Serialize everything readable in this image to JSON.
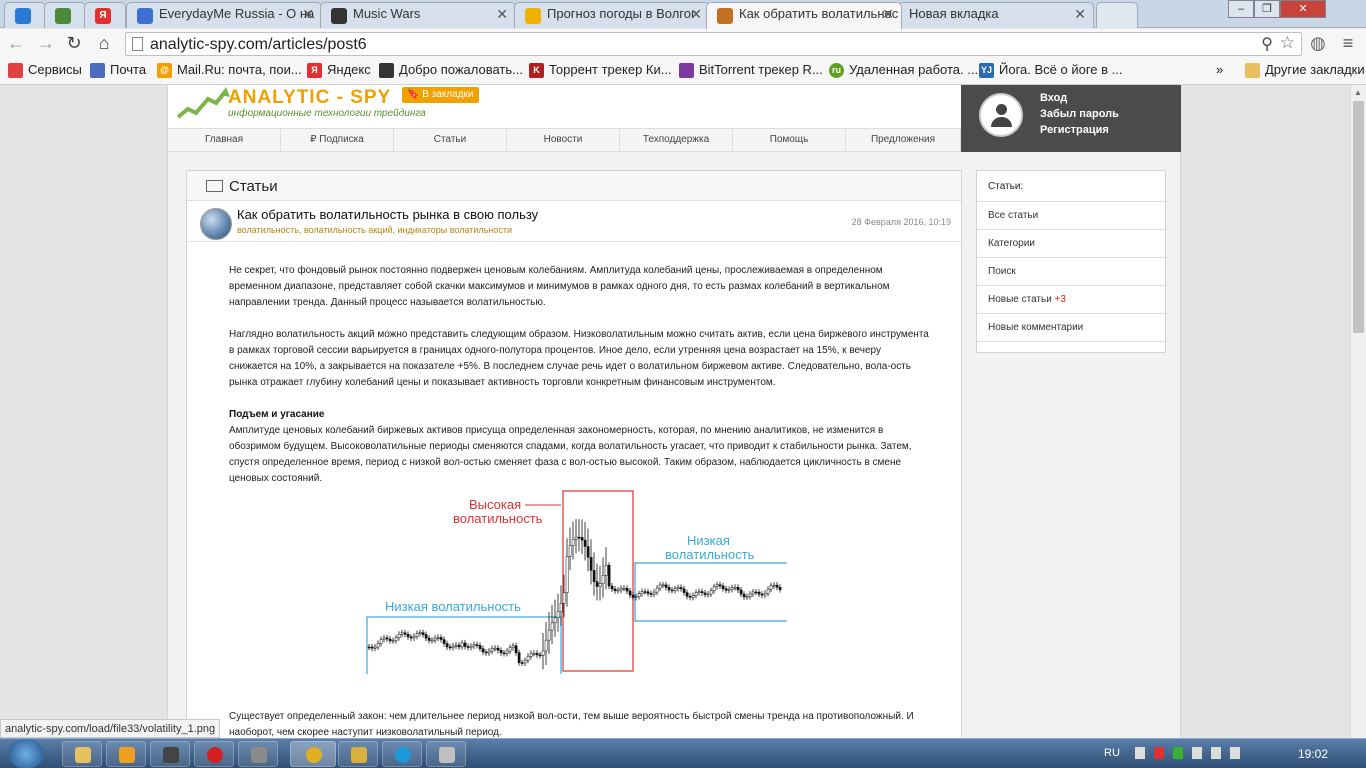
{
  "browser": {
    "tabs": [
      {
        "title": "",
        "icon": "generic-tab-icon",
        "color": "#2b7bd6"
      },
      {
        "title": "",
        "icon": "chart-tab-icon",
        "color": "#4a8a3a"
      },
      {
        "title": "",
        "icon": "yandex-tab-icon",
        "color": "#e03030"
      },
      {
        "title": "EverydayMe Russia - О на",
        "icon": "everydayme-icon",
        "color": "#3b6fd0"
      },
      {
        "title": "Music Wars",
        "icon": "musicwars-icon",
        "color": "#333"
      },
      {
        "title": "Прогноз погоды в Волгог",
        "icon": "weather-icon",
        "color": "#f0b000"
      },
      {
        "title": "Как обратить волатильнос",
        "icon": "article-icon",
        "color": "#c07020"
      },
      {
        "title": "Новая вкладка",
        "icon": "",
        "color": ""
      }
    ],
    "window_buttons": [
      "‒",
      "❐",
      "✕"
    ],
    "url": "analytic-spy.com/articles/post6",
    "bookmarks": [
      {
        "label": "Сервисы",
        "color": "#e04040"
      },
      {
        "label": "Почта",
        "color": "#4a6cc0"
      },
      {
        "label": "Mail.Ru: почта, пои...",
        "color": "#f0a000"
      },
      {
        "label": "Яндекс",
        "color": "#e03030"
      },
      {
        "label": "Добро пожаловать...",
        "color": "#333"
      },
      {
        "label": "Торрент трекер Ки...",
        "color": "#b02020"
      },
      {
        "label": "BitTorrent трекер R...",
        "color": "#7a3aa0"
      },
      {
        "label": "Удаленная работа. ...",
        "color": "#60a020"
      },
      {
        "label": "Йога. Всё о йоге в ...",
        "color": "#2a6ab0"
      }
    ],
    "bookmarks_more": "»",
    "other_bookmarks": "Другие закладки",
    "status_url": "analytic-spy.com/load/file33/volatility_1.png"
  },
  "site": {
    "logo": "ANALYTIC - SPY",
    "tagline": "информационные технологии трейдинга",
    "bookmark_btn": "В закладки",
    "nav": [
      "Главная",
      "₽ Подписка",
      "Статьи",
      "Новости",
      "Техподдержка",
      "Помощь",
      "Предложения"
    ],
    "login": {
      "enter": "Вход",
      "forgot": "Забыл пароль",
      "register": "Регистрация"
    },
    "section_title": "Статьи",
    "article": {
      "title": "Как обратить волатильность рынка в свою пользу",
      "tags": "волатильность, волатильность акций, индикаторы волатильности",
      "date": "28 Февраля 2016, 10:19",
      "p1": "Не секрет, что фондовый рынок постоянно подвержен ценовым колебаниям. Амплитуда колебаний цены, прослеживаемая в определенном временном диапазоне, представляет собой скачки максимумов и минимумов в рамках одного дня, то есть размах колебаний в вертикальном направлении тренда. Данный процесс называется волатильностью.",
      "p2": "Наглядно волатильность акций можно представить следующим образом. Низковолатильным можно считать актив, если цена биржевого инструмента в рамках торговой сессии варьируется в границах одного-полутора процентов. Иное дело, если утренняя цена возрастает на 15%, к вечеру снижается на 10%, а закрывается на показателе +5%. В последнем случае речь идет о волатильном биржевом активе. Следовательно, вола-ость рынка отражает глубину колебаний цены и показывает активность торговли конкретным финансовым инструментом.",
      "subheading": "Подъем и угасание",
      "p3": "Амплитуде ценовых колебаний биржевых активов присуща определенная закономерность, которая, по мнению аналитиков, не изменится в обозримом будущем. Высоковолатильные периоды сменяются спадами, когда волатильность угасает, что приводит к стабильности рынка. Затем, спустя определенное время, период с низкой вол-остью сменяет фаза с вол-остью высокой. Таким образом, наблюдается цикличность в смене ценовых состояний.",
      "p4": "Существует определенный закон: чем длительнее период низкой вол-ости, тем выше вероятность быстрой смены тренда на противоположный. И",
      "p5": "наоборот, чем скорее наступит низковолатильный период."
    },
    "chart": {
      "label_low_left": "Низкая волатильность",
      "label_high": "Высокая\nволатильность",
      "label_low_right": "Низкая\nволатильность",
      "colors": {
        "low": "#3aa8d8",
        "high": "#e03030"
      }
    },
    "sidebar": {
      "heading": "Статьи:",
      "items": [
        {
          "label": "Все статьи",
          "count": ""
        },
        {
          "label": "Категории",
          "count": ""
        },
        {
          "label": "Поиск",
          "count": ""
        },
        {
          "label": "Новые статьи",
          "count": "+3"
        },
        {
          "label": "Новые комментарии",
          "count": ""
        }
      ]
    }
  },
  "taskbar": {
    "lang": "RU",
    "time": "19:02"
  }
}
